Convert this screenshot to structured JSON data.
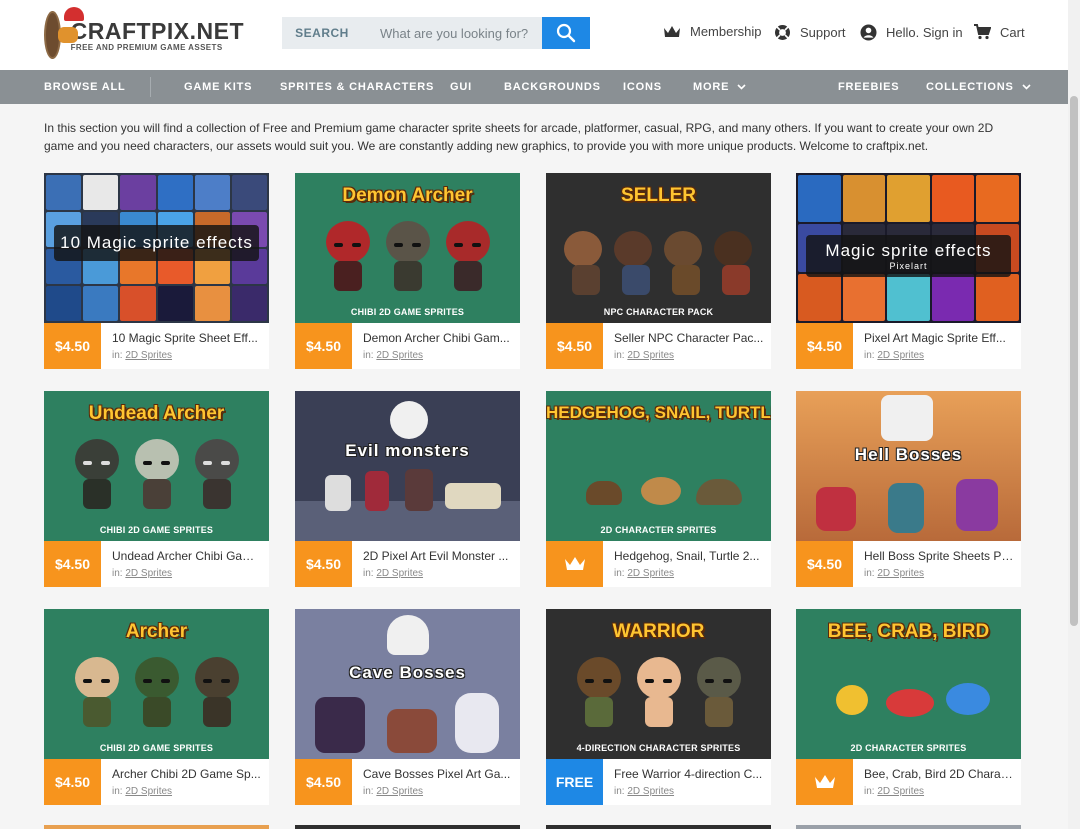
{
  "header": {
    "logo_title": "CRAFTPIX.NET",
    "logo_sub": "FREE AND PREMIUM GAME ASSETS",
    "search_label": "SEARCH",
    "search_placeholder": "What are you looking for?",
    "membership": "Membership",
    "support": "Support",
    "signin": "Hello. Sign in",
    "cart": "Cart"
  },
  "nav": {
    "browse_all": "BROWSE ALL",
    "items": [
      "GAME KITS",
      "SPRITES & CHARACTERS",
      "GUI",
      "BACKGROUNDS",
      "ICONS",
      "MORE"
    ],
    "freebies": "FREEBIES",
    "collections": "COLLECTIONS"
  },
  "intro": "In this section you will find a collection of Free and Premium game character sprite sheets for arcade, platformer, casual, RPG, and many others. If you want to create your own 2D game and you need characters, our assets would suit you. We are constantly adding new graphics, to provide you with more unique products. Welcome to craftpix.net.",
  "category_prefix": "in:",
  "products": [
    {
      "title": "10 Magic Sprite Sheet Eff...",
      "price": "$4.50",
      "category": "2D Sprites",
      "thumb_title": "10 Magic sprite effects",
      "thumb_sub": ""
    },
    {
      "title": "Demon Archer Chibi Gam...",
      "price": "$4.50",
      "category": "2D Sprites",
      "thumb_title": "Demon Archer",
      "thumb_sub": "CHIBI 2D GAME SPRITES"
    },
    {
      "title": "Seller NPC Character Pac...",
      "price": "$4.50",
      "category": "2D Sprites",
      "thumb_title": "SELLER",
      "thumb_sub": "NPC CHARACTER PACK"
    },
    {
      "title": "Pixel Art Magic Sprite Eff...",
      "price": "$4.50",
      "category": "2D Sprites",
      "thumb_title": "Magic sprite effects",
      "thumb_sub": "Pixelart"
    },
    {
      "title": "Undead Archer Chibi Gam...",
      "price": "$4.50",
      "category": "2D Sprites",
      "thumb_title": "Undead Archer",
      "thumb_sub": "CHIBI 2D GAME SPRITES"
    },
    {
      "title": "2D Pixel Art Evil Monster ...",
      "price": "$4.50",
      "category": "2D Sprites",
      "thumb_title": "Evil monsters",
      "thumb_sub": ""
    },
    {
      "title": "Hedgehog, Snail, Turtle 2...",
      "price": "",
      "category": "2D Sprites",
      "thumb_title": "HEDGEHOG, SNAIL, TURTLE",
      "thumb_sub": "2D CHARACTER SPRITES"
    },
    {
      "title": "Hell Boss Sprite Sheets Pi...",
      "price": "$4.50",
      "category": "2D Sprites",
      "thumb_title": "Hell Bosses",
      "thumb_sub": ""
    },
    {
      "title": "Archer Chibi 2D Game Sp...",
      "price": "$4.50",
      "category": "2D Sprites",
      "thumb_title": "Archer",
      "thumb_sub": "CHIBI 2D GAME SPRITES"
    },
    {
      "title": "Cave Bosses Pixel Art Ga...",
      "price": "$4.50",
      "category": "2D Sprites",
      "thumb_title": "Cave Bosses",
      "thumb_sub": ""
    },
    {
      "title": "Free Warrior 4-direction C...",
      "price": "FREE",
      "category": "2D Sprites",
      "thumb_title": "WARRIOR",
      "thumb_sub": "4-DIRECTION CHARACTER SPRITES"
    },
    {
      "title": "Bee, Crab, Bird 2D Charac...",
      "price": "",
      "category": "2D Sprites",
      "thumb_title": "BEE, CRAB, BIRD",
      "thumb_sub": "2D CHARACTER SPRITES"
    }
  ],
  "colors": {
    "accent_orange": "#f7941d",
    "accent_blue": "#1e88e5",
    "nav_bg": "#8a9094",
    "thumb_green": "#2e8060",
    "thumb_dark": "#2f2f2f"
  }
}
